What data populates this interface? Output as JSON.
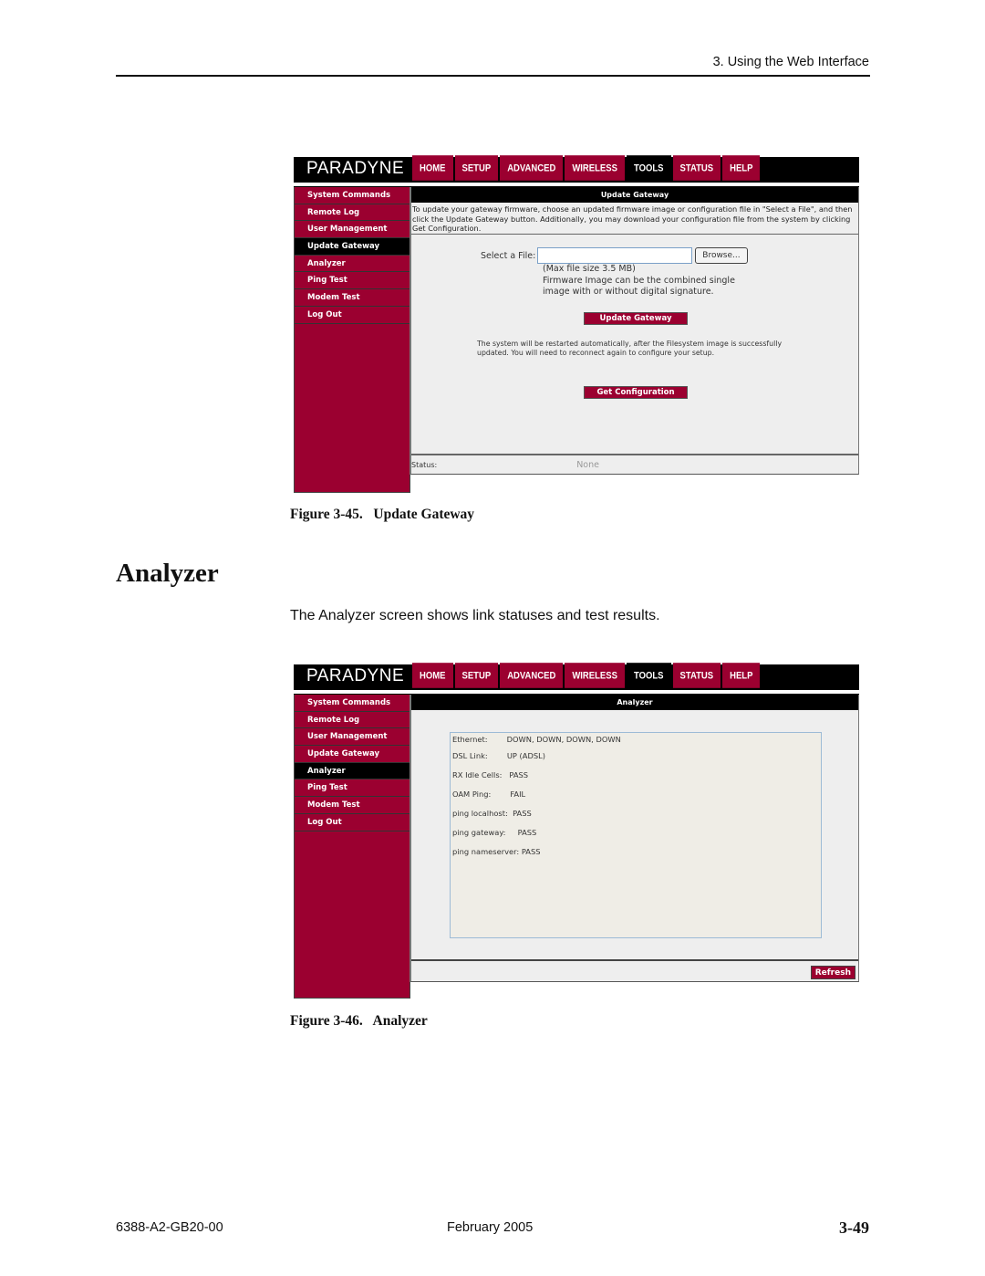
{
  "page": {
    "running_head": "3. Using the Web Interface",
    "section_title": "Analyzer",
    "body_text": "The Analyzer screen shows link statuses and test results.",
    "footer": {
      "doc_number": "6388-A2-GB20-00",
      "date": "February 2005",
      "page_number": "3-49"
    }
  },
  "router_ui": {
    "logo": "PARADYNE",
    "tabs": [
      {
        "label": "HOME"
      },
      {
        "label": "SETUP"
      },
      {
        "label": "ADVANCED"
      },
      {
        "label": "WIRELESS"
      },
      {
        "label": "TOOLS",
        "active": true
      },
      {
        "label": "STATUS"
      },
      {
        "label": "HELP"
      }
    ],
    "sidebar": [
      {
        "label": "System Commands"
      },
      {
        "label": "Remote Log"
      },
      {
        "label": "User Management"
      },
      {
        "label": "Update Gateway"
      },
      {
        "label": "Analyzer"
      },
      {
        "label": "Ping Test"
      },
      {
        "label": "Modem Test"
      },
      {
        "label": "Log Out"
      }
    ],
    "colors": {
      "brand": "#9b0030",
      "active": "#000000",
      "panel": "#eeeeee"
    }
  },
  "figure1": {
    "caption": "Figure 3-45.   Update Gateway",
    "active_sidebar": "Update Gateway",
    "panel_title": "Update Gateway",
    "intro": "To update your gateway firmware, choose an updated firmware image or configuration file in \"Select a File\", and then click the Update Gateway button. Additionally, you may download your configuration file from the system by clicking Get Configuration.",
    "select_file_label": "Select a File:",
    "file_value": "",
    "browse_label": "Browse...",
    "max_size_note": "(Max file size 3.5 MB)",
    "firmware_note_1": "Firmware Image can be the combined single",
    "firmware_note_2": "image with or without digital signature.",
    "update_button": "Update Gateway",
    "restart_note": "The system will be restarted automatically, after the Filesystem image is successfully updated. You will need to reconnect again to configure your setup.",
    "get_config_button": "Get Configuration",
    "status_label": "Status:",
    "status_value": "None"
  },
  "figure2": {
    "caption": "Figure 3-46.   Analyzer",
    "active_sidebar": "Analyzer",
    "panel_title": "Analyzer",
    "results": [
      {
        "label": "Ethernet:        ",
        "value": "DOWN, DOWN, DOWN, DOWN"
      },
      {
        "label": "DSL Link:        ",
        "value": "UP (ADSL)"
      },
      {
        "label": "RX Idle Cells:   ",
        "value": "PASS"
      },
      {
        "label": "OAM Ping:        ",
        "value": "FAIL"
      },
      {
        "label": "ping localhost:  ",
        "value": "PASS"
      },
      {
        "label": "ping gateway:     ",
        "value": "PASS"
      },
      {
        "label": "ping nameserver: ",
        "value": "PASS"
      }
    ],
    "refresh_button": "Refresh"
  }
}
